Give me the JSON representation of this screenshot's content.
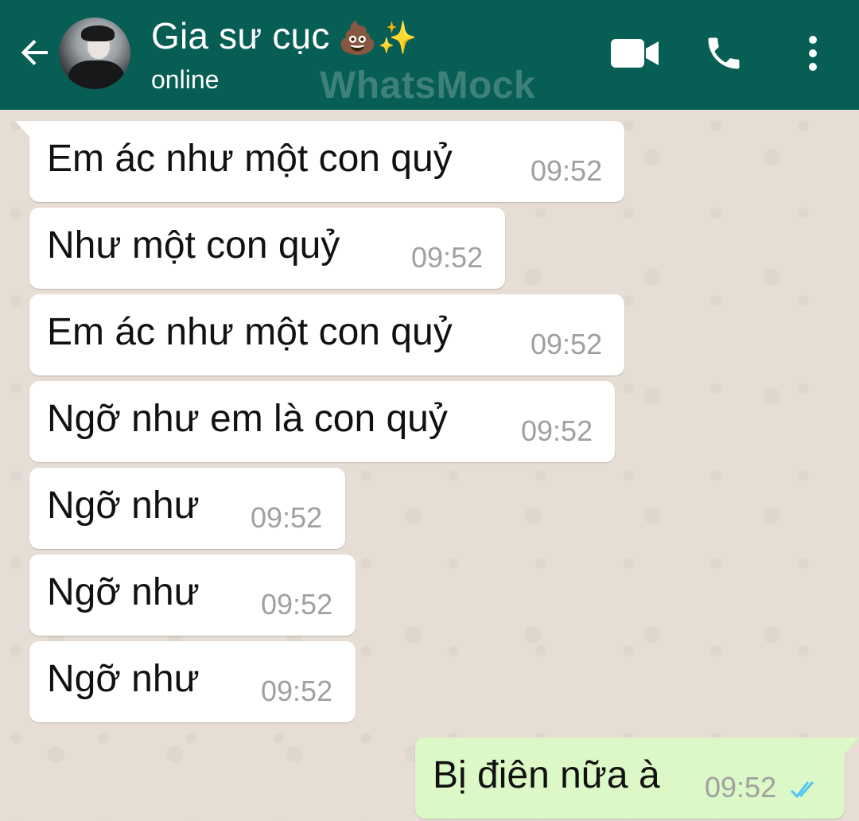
{
  "header": {
    "back_icon": "arrow-left-icon",
    "contact_name": "Gia sư cục",
    "contact_emoji": "💩✨",
    "status": "online",
    "watermark": "WhatsMock",
    "video_icon": "video-camera-icon",
    "call_icon": "phone-icon",
    "menu_icon": "more-vertical-icon"
  },
  "colors": {
    "header": "#075e54",
    "chat_background": "#e6ddd4",
    "incoming_bubble": "#ffffff",
    "outgoing_bubble": "#dcf8c6",
    "read_ticks": "#4fc3f7",
    "timestamp": "#a0a0a0"
  },
  "messages": [
    {
      "direction": "incoming",
      "text": "Em ác như một con quỷ",
      "time": "09:52"
    },
    {
      "direction": "incoming",
      "text": "Như một con quỷ",
      "time": "09:52"
    },
    {
      "direction": "incoming",
      "text": "Em ác như một con quỷ",
      "time": "09:52"
    },
    {
      "direction": "incoming",
      "text": "Ngỡ như em là con quỷ",
      "time": "09:52"
    },
    {
      "direction": "incoming",
      "text": "Ngỡ như",
      "time": "09:52"
    },
    {
      "direction": "incoming",
      "text": "Ngỡ như",
      "time": "09:52"
    },
    {
      "direction": "incoming",
      "text": "Ngỡ như",
      "time": "09:52"
    },
    {
      "direction": "outgoing",
      "text": "Bị điên nữa à",
      "time": "09:52",
      "status": "read",
      "status_icon": "double-check-icon"
    }
  ]
}
